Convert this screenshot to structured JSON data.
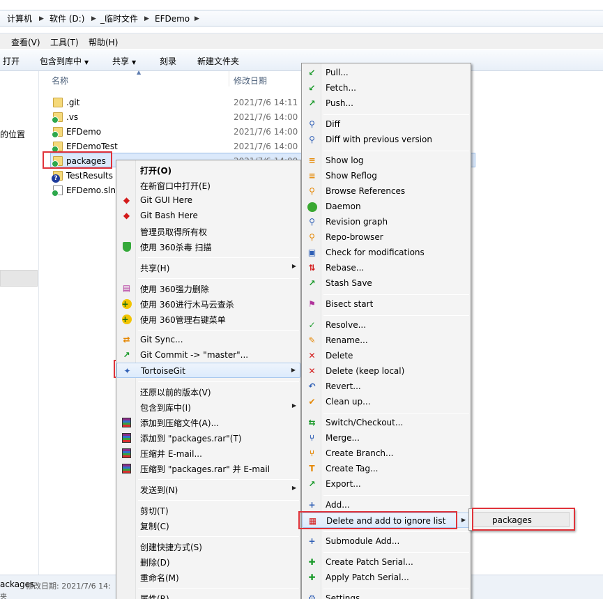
{
  "breadcrumb": [
    "计算机",
    "软件 (D:)",
    "_临时文件",
    "EFDemo"
  ],
  "menubar": [
    "查看(V)",
    "工具(T)",
    "帮助(H)"
  ],
  "toolbar": {
    "open": "打开",
    "include": "包含到库中",
    "share": "共享",
    "burn": "刻录",
    "new_folder": "新建文件夹"
  },
  "nav": {
    "partial_label": "的位置"
  },
  "columns": {
    "name": "名称",
    "date": "修改日期"
  },
  "files": [
    {
      "name": ".git",
      "date": "2021/7/6 14:11",
      "icon": "folder-icon"
    },
    {
      "name": ".vs",
      "date": "2021/7/6 14:00",
      "icon": "folder-git-clean-icon"
    },
    {
      "name": "EFDemo",
      "date": "2021/7/6 14:00",
      "icon": "folder-git-clean-icon"
    },
    {
      "name": "EFDemoTest",
      "date": "2021/7/6 14:00",
      "icon": "folder-git-clean-icon"
    },
    {
      "name": "packages",
      "date": "2021/7/6 14:00",
      "icon": "folder-git-clean-icon"
    },
    {
      "name": "TestResults",
      "date": "",
      "icon": "folder-git-unversioned-icon"
    },
    {
      "name": "EFDemo.sln",
      "date": "",
      "icon": "file-git-clean-icon"
    }
  ],
  "status": {
    "name": "ackages",
    "meta": "修改日期: 2021/7/6 14:",
    "sub": "夹"
  },
  "context_menu": [
    {
      "label": "打开(O)",
      "bold": true,
      "icon": ""
    },
    {
      "label": "在新窗口中打开(E)",
      "icon": ""
    },
    {
      "label": "Git GUI Here",
      "icon": "git-gui-icon"
    },
    {
      "label": "Git Bash Here",
      "icon": "git-bash-icon"
    },
    {
      "label": "管理员取得所有权",
      "icon": ""
    },
    {
      "label": "使用 360杀毒 扫描",
      "icon": "shield-icon"
    },
    {
      "label": "共享(H)",
      "icon": "",
      "submenu": true
    },
    {
      "label": "使用 360强力删除",
      "icon": "shredder-icon"
    },
    {
      "label": "使用 360进行木马云查杀",
      "icon": "cloud-scan-icon"
    },
    {
      "label": "使用 360管理右键菜单",
      "icon": "menu-manager-icon"
    },
    {
      "label": "Git Sync...",
      "icon": "git-sync-icon"
    },
    {
      "label": "Git Commit -> \"master\"...",
      "icon": "git-commit-icon"
    },
    {
      "label": "TortoiseGit",
      "icon": "tortoise-icon",
      "submenu": true
    },
    {
      "label": "还原以前的版本(V)",
      "icon": ""
    },
    {
      "label": "包含到库中(I)",
      "icon": "",
      "submenu": true
    },
    {
      "label": "添加到压缩文件(A)...",
      "icon": "rar-icon"
    },
    {
      "label": "添加到 \"packages.rar\"(T)",
      "icon": "rar-icon"
    },
    {
      "label": "压缩并 E-mail...",
      "icon": "rar-icon"
    },
    {
      "label": "压缩到 \"packages.rar\" 并 E-mail",
      "icon": "rar-icon"
    },
    {
      "label": "发送到(N)",
      "icon": "",
      "submenu": true
    },
    {
      "label": "剪切(T)",
      "icon": ""
    },
    {
      "label": "复制(C)",
      "icon": ""
    },
    {
      "label": "创建快捷方式(S)",
      "icon": ""
    },
    {
      "label": "删除(D)",
      "icon": ""
    },
    {
      "label": "重命名(M)",
      "icon": ""
    },
    {
      "label": "属性(R)",
      "icon": ""
    }
  ],
  "tortoise_menu": [
    {
      "label": "Pull...",
      "icon": "pull-icon"
    },
    {
      "label": "Fetch...",
      "icon": "fetch-icon"
    },
    {
      "label": "Push...",
      "icon": "push-icon"
    },
    {
      "label": "Diff",
      "icon": "diff-icon"
    },
    {
      "label": "Diff with previous version",
      "icon": "diff-icon"
    },
    {
      "label": "Show log",
      "icon": "log-icon"
    },
    {
      "label": "Show Reflog",
      "icon": "log-icon"
    },
    {
      "label": "Browse References",
      "icon": "search-icon"
    },
    {
      "label": "Daemon",
      "icon": "globe-icon"
    },
    {
      "label": "Revision graph",
      "icon": "graph-icon"
    },
    {
      "label": "Repo-browser",
      "icon": "search-icon"
    },
    {
      "label": "Check for modifications",
      "icon": "modifications-icon"
    },
    {
      "label": "Rebase...",
      "icon": "rebase-icon"
    },
    {
      "label": "Stash Save",
      "icon": "stash-icon"
    },
    {
      "label": "Bisect start",
      "icon": "bisect-icon"
    },
    {
      "label": "Resolve...",
      "icon": "resolve-icon"
    },
    {
      "label": "Rename...",
      "icon": "rename-icon"
    },
    {
      "label": "Delete",
      "icon": "delete-icon"
    },
    {
      "label": "Delete (keep local)",
      "icon": "delete-icon"
    },
    {
      "label": "Revert...",
      "icon": "revert-icon"
    },
    {
      "label": "Clean up...",
      "icon": "cleanup-icon"
    },
    {
      "label": "Switch/Checkout...",
      "icon": "switch-icon"
    },
    {
      "label": "Merge...",
      "icon": "merge-icon"
    },
    {
      "label": "Create Branch...",
      "icon": "branch-icon"
    },
    {
      "label": "Create Tag...",
      "icon": "tag-icon"
    },
    {
      "label": "Export...",
      "icon": "export-icon"
    },
    {
      "label": "Add...",
      "icon": "add-icon"
    },
    {
      "label": "Delete and add to ignore list",
      "icon": "ignore-icon",
      "submenu": true
    },
    {
      "label": "Submodule Add...",
      "icon": "add-icon"
    },
    {
      "label": "Create Patch Serial...",
      "icon": "patch-icon"
    },
    {
      "label": "Apply Patch Serial...",
      "icon": "patch-icon"
    },
    {
      "label": "Settings",
      "icon": "settings-icon"
    }
  ],
  "ignore_submenu": [
    {
      "label": "packages"
    }
  ],
  "colors": {
    "highlight": "#e0333a",
    "selection": "#dbe9fb",
    "menu_bg": "#f4f4f4"
  }
}
